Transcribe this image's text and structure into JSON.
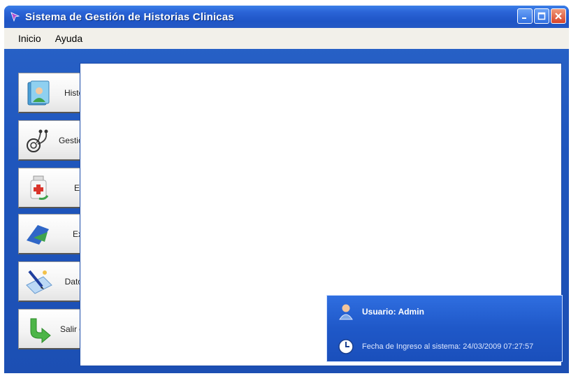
{
  "window": {
    "title": "Sistema de Gestión de Historias Clinicas"
  },
  "menu": {
    "items": [
      "Inicio",
      "Ayuda"
    ]
  },
  "sidebar": {
    "buttons": [
      {
        "label": "Historias Clinicas",
        "icon": "patient-folder-icon"
      },
      {
        "label": "Gestionar Medicos",
        "icon": "stethoscope-icon"
      },
      {
        "label": "Enfermedades",
        "icon": "medicine-bottle-icon"
      },
      {
        "label": "Exportar Datos",
        "icon": "export-arrow-icon"
      },
      {
        "label": "Datos e Informes",
        "icon": "report-pen-icon"
      },
      {
        "label": "Salir del programa",
        "icon": "exit-arrow-icon"
      }
    ]
  },
  "status": {
    "user": "Usuario: Admin",
    "login_date": "Fecha de Ingreso al sistema: 24/03/2009 07:27:57"
  },
  "colors": {
    "window_blue": "#1f56bd",
    "title_blue": "#2a63d6",
    "close_red": "#d8442a",
    "menu_bg": "#f2f0ea"
  }
}
